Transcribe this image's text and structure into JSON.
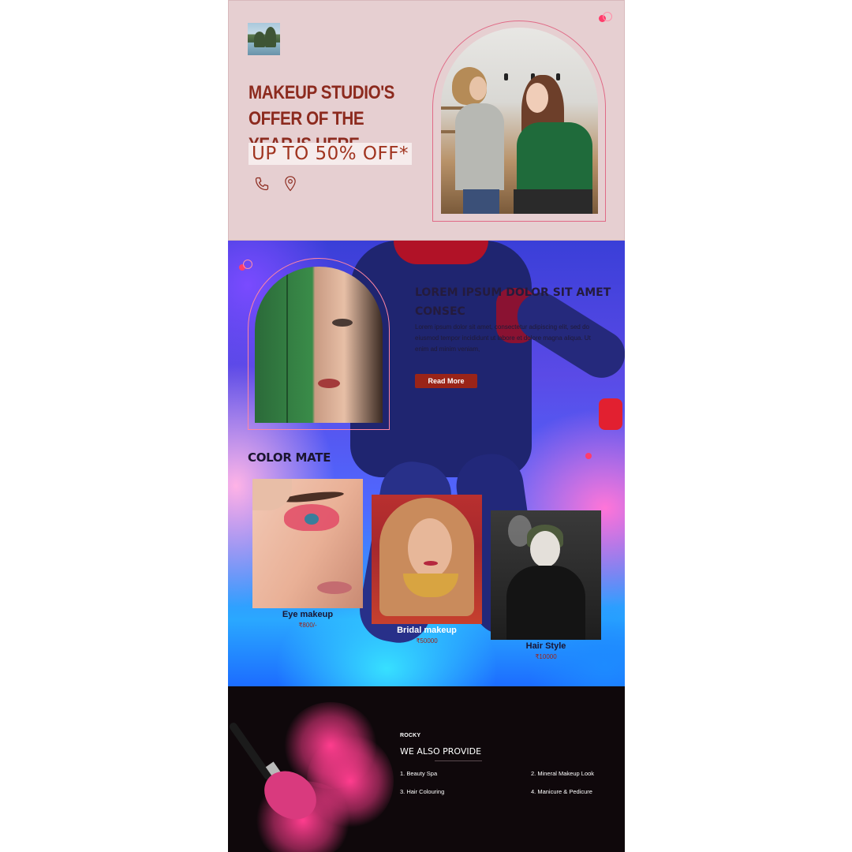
{
  "hero": {
    "title": "MAKEUP STUDIO'S OFFER OF THE YEAR IS HERE",
    "offer": "UP TO 50% OFF*",
    "icons": [
      "phone-icon",
      "location-pin-icon"
    ]
  },
  "intro": {
    "title": "LOREM IPSUM DOLOR SIT AMET CONSEC",
    "text": "Lorem ipsum dolor sit amet, consectetur adipiscing elit, sed do eiusmod tempor incididunt ut labore et dolore magna aliqua. Ut enim ad minim veniam,",
    "button": "Read More"
  },
  "color_mate": {
    "title": "COLOR MATE",
    "cards": [
      {
        "name": "Eye makeup",
        "price": "₹800/-"
      },
      {
        "name": "Bridal makeup",
        "price": "₹50000"
      },
      {
        "name": "Hair Style",
        "price": "₹10000"
      }
    ]
  },
  "footer": {
    "brand": "ROCKY",
    "title": "WE ALSO PROVIDE",
    "services": [
      "1. Beauty Spa",
      "2. Mineral Makeup Look",
      "3. Hair Colouring",
      "4. Manicure & Pedicure"
    ]
  },
  "colors": {
    "accent": "#9a2418",
    "hero_bg": "#e6cfd1",
    "footer_bg": "#0f080b",
    "pink_dot": "#ff3d6b"
  }
}
